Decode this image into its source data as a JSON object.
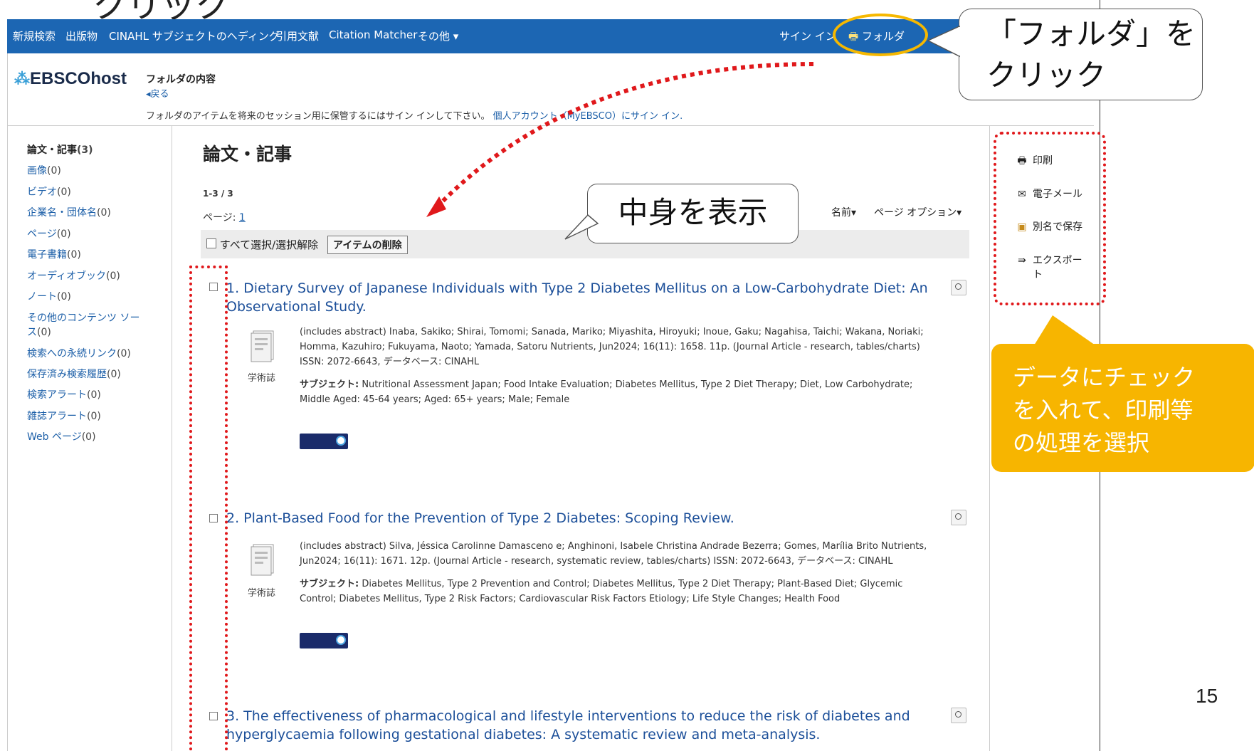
{
  "top_partial_text": "クリック",
  "nav": {
    "items": [
      "新規検索",
      "出版物",
      "CINAHL サブジェクトのヘディング",
      "引用文献",
      "Citation Matcher",
      "その他 ▾"
    ],
    "signin": "サイン イン",
    "folder": "フォルダ"
  },
  "header": {
    "logo": "EBSCOhost",
    "folder_title": "フォルダの内容",
    "back": "◂戻る",
    "signin_note": "フォルダのアイテムを将来のセッション用に保管するにはサイン インして下さい。",
    "signin_link": "個人アカウント（MyEBSCO）にサイン イン."
  },
  "sidebar": {
    "items": [
      {
        "label": "論文・記事",
        "count": "(3)"
      },
      {
        "label": "画像",
        "count": "(0)"
      },
      {
        "label": "ビデオ",
        "count": "(0)"
      },
      {
        "label": "企業名・団体名",
        "count": "(0)"
      },
      {
        "label": "ページ",
        "count": "(0)"
      },
      {
        "label": "電子書籍",
        "count": "(0)"
      },
      {
        "label": "オーディオブック",
        "count": "(0)"
      },
      {
        "label": "ノート",
        "count": "(0)"
      },
      {
        "label": "その他のコンテンツ ソー",
        "count": ""
      },
      {
        "label": "ス",
        "count": "(0)"
      },
      {
        "label": "検索への永続リンク",
        "count": "(0)"
      },
      {
        "label": "保存済み検索履歴",
        "count": "(0)"
      },
      {
        "label": "検索アラート",
        "count": "(0)"
      },
      {
        "label": "雑誌アラート",
        "count": "(0)"
      },
      {
        "label": "Web ページ",
        "count": "(0)"
      }
    ]
  },
  "main": {
    "title": "論文・記事",
    "result_count": "1-3 / 3",
    "page_label": "ページ: ",
    "page_num": "1",
    "select_all": "すべて選択/選択解除",
    "delete": "アイテムの削除",
    "sort_name": "名前▾",
    "page_options": "ページ オプション▾"
  },
  "results": [
    {
      "title_line1": "1. Dietary Survey of Japanese Individuals with Type 2 Diabetes Mellitus on a Low-Carbohydrate Diet: An",
      "title_line2": "Observational Study.",
      "meta": "(includes abstract) Inaba, Sakiko; Shirai, Tomomi; Sanada, Mariko; Miyashita, Hiroyuki; Inoue, Gaku; Nagahisa, Taichi; Wakana, Noriaki; Homma, Kazuhiro; Fukuyama, Naoto; Yamada, Satoru Nutrients, Jun2024; 16(11): 1658. 11p. (Journal Article - research, tables/charts) ISSN: 2072-6643, データベース: CINAHL",
      "subject_label": "サブジェクト:",
      "subject": " Nutritional Assessment Japan; Food Intake Evaluation; Diabetes Mellitus, Type 2 Diet Therapy; Diet, Low Carbohydrate; Middle Aged: 45-64 years; Aged: 65+ years; Male; Female",
      "doctype": "学術誌"
    },
    {
      "title_line1": "2. Plant-Based Food for the Prevention of Type 2 Diabetes: Scoping Review.",
      "title_line2": "",
      "meta": "(includes abstract) Silva, Jéssica Carolinne Damasceno e; Anghinoni, Isabele Christina Andrade Bezerra; Gomes, Marília Brito Nutrients, Jun2024; 16(11): 1671. 12p. (Journal Article - research, systematic review, tables/charts) ISSN: 2072-6643, データベース: CINAHL",
      "subject_label": "サブジェクト:",
      "subject": " Diabetes Mellitus, Type 2 Prevention and Control; Diabetes Mellitus, Type 2 Diet Therapy; Plant-Based Diet; Glycemic Control; Diabetes Mellitus, Type 2 Risk Factors; Cardiovascular Risk Factors Etiology; Life Style Changes; Health Food",
      "doctype": "学術誌"
    },
    {
      "title_line1": "3. The effectiveness of pharmacological and lifestyle interventions to reduce the risk of diabetes and",
      "title_line2": "hyperglycaemia following gestational diabetes: A systematic review and meta-analysis."
    }
  ],
  "tools": [
    "印刷",
    "電子メール",
    "別名で保存",
    "エクスポー",
    "ト"
  ],
  "annotations": {
    "folder_callout_line1": "「フォルダ」を",
    "folder_callout_line2": "クリック",
    "show_callout": "中身を表示",
    "check_callout_line1": "データにチェック",
    "check_callout_line2": "を入れて、印刷等",
    "check_callout_line3": "の処理を選択"
  },
  "page_number": "15",
  "colors": {
    "nav_bg": "#1c66b3",
    "highlight": "#f6b800",
    "annotation_red": "#e0181b",
    "callout_yellow": "#f7b500"
  }
}
